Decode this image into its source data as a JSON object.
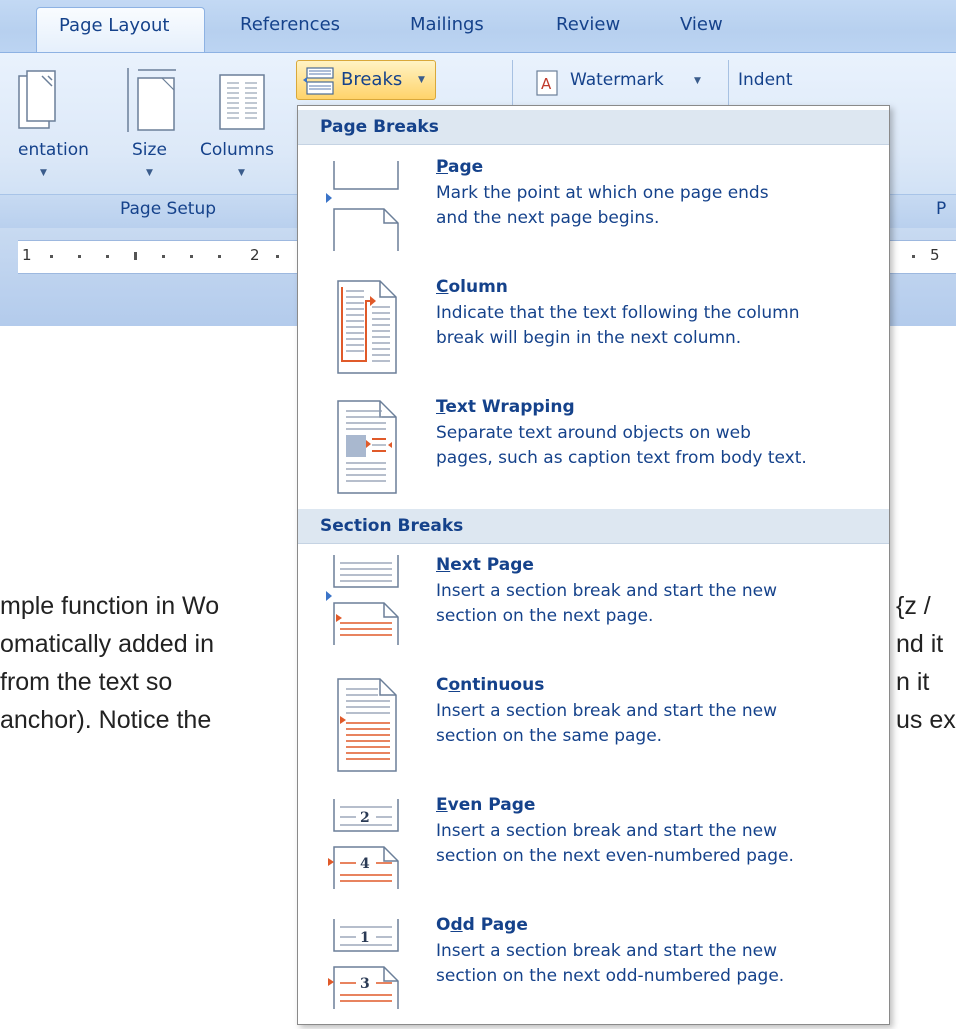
{
  "tabs": [
    "Page Layout",
    "References",
    "Mailings",
    "Review",
    "View"
  ],
  "ribbon": {
    "orientation_label": "entation",
    "size_label": "Size",
    "columns_label": "Columns",
    "breaks_label": "Breaks",
    "watermark_label": "Watermark",
    "indent_label": "Indent",
    "page_setup_caption": "Page Setup",
    "right_caption": "P"
  },
  "ruler": {
    "numbers": [
      "1",
      "2",
      "5"
    ]
  },
  "document": {
    "lines": [
      {
        "left": "mple function in Wo",
        "right": "{z /"
      },
      {
        "left": "omatically added in",
        "right": "nd it"
      },
      {
        "left": " from  the  text  so",
        "right": "n  it"
      },
      {
        "left": "anchor).  Notice the",
        "right": "us ex"
      }
    ]
  },
  "menu": {
    "page_breaks_header": "Page Breaks",
    "section_breaks_header": "Section Breaks",
    "items": [
      {
        "title_pre": "",
        "title_ul": "P",
        "title_post": "age",
        "desc1": "Mark the point at which one page ends",
        "desc2": "and the next page begins.",
        "icon": "page-break-icon"
      },
      {
        "title_pre": "",
        "title_ul": "C",
        "title_post": "olumn",
        "desc1": "Indicate that the text following the column",
        "desc2": "break will begin in the next column.",
        "icon": "column-break-icon"
      },
      {
        "title_pre": "",
        "title_ul": "T",
        "title_post": "ext Wrapping",
        "desc1": "Separate text around objects on web",
        "desc2": "pages, such as caption text from body text.",
        "icon": "text-wrapping-icon"
      },
      {
        "title_pre": "",
        "title_ul": "N",
        "title_post": "ext Page",
        "desc1": "Insert a section break and start the new",
        "desc2": "section on the next page.",
        "icon": "next-page-icon"
      },
      {
        "title_pre": "C",
        "title_ul": "o",
        "title_post": "ntinuous",
        "desc1": "Insert a section break and start the new",
        "desc2": "section on the same page.",
        "icon": "continuous-icon"
      },
      {
        "title_pre": "",
        "title_ul": "E",
        "title_post": "ven Page",
        "desc1": "Insert a section break and start the new",
        "desc2": "section on the next even-numbered page.",
        "icon": "even-page-icon"
      },
      {
        "title_pre": "O",
        "title_ul": "d",
        "title_post": "d Page",
        "desc1": "Insert a section break and start the new",
        "desc2": "section on the next odd-numbered page.",
        "icon": "odd-page-icon"
      }
    ],
    "icon_numbers": {
      "even_top": "2",
      "even_bottom": "4",
      "odd_top": "1",
      "odd_bottom": "3"
    }
  },
  "colors": {
    "accent": "#15428b",
    "red_line": "#e05a2a",
    "menu_header_bg": "#dde7f1"
  }
}
